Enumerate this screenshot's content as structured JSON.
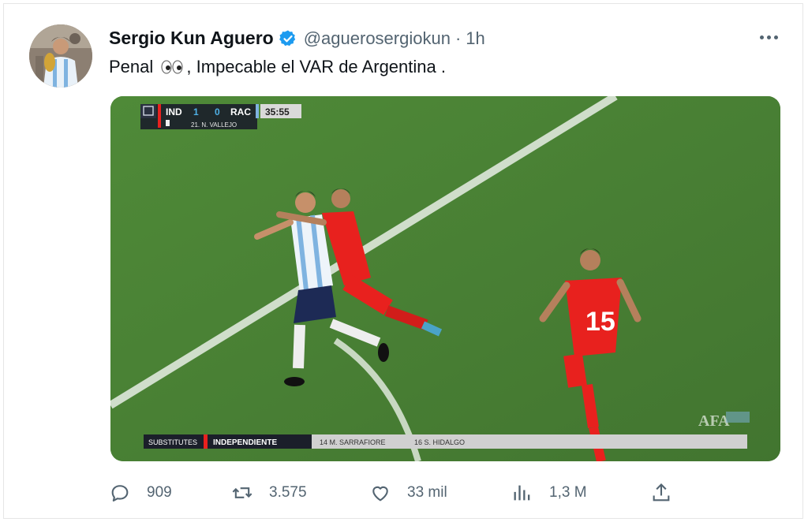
{
  "tweet": {
    "author_name": "Sergio Kun Aguero",
    "handle": "@aguerosergiokun",
    "separator": "·",
    "time": "1h",
    "text_before_emoji": "Penal",
    "text_after_emoji": ", Impecable el VAR de Argentina ."
  },
  "video": {
    "scoreboard": {
      "home": "IND",
      "home_score": "1",
      "away_score": "0",
      "away": "RAC",
      "clock": "35:55",
      "card_player": "21. N. VALLEJO"
    },
    "substitutes_bar": {
      "label": "SUBSTITUTES",
      "team": "INDEPENDIENTE",
      "player_out": "14 M. SARRAFIORE",
      "player_in": "16 S. HIDALGO"
    },
    "shirt_number": "15",
    "watermark": "AFA"
  },
  "actions": {
    "replies": "909",
    "retweets": "3.575",
    "likes": "33 mil",
    "views": "1,3 M"
  },
  "colors": {
    "verified": "#1d9bf0",
    "text_secondary": "#536471",
    "pitch": "#4a7d36",
    "independiente_red": "#e8211e",
    "racing_blue": "#7fb3e0"
  },
  "icons": [
    "verified-badge-icon",
    "more-options-icon",
    "reply-icon",
    "retweet-icon",
    "like-icon",
    "views-icon",
    "share-icon",
    "eyes-emoji"
  ]
}
